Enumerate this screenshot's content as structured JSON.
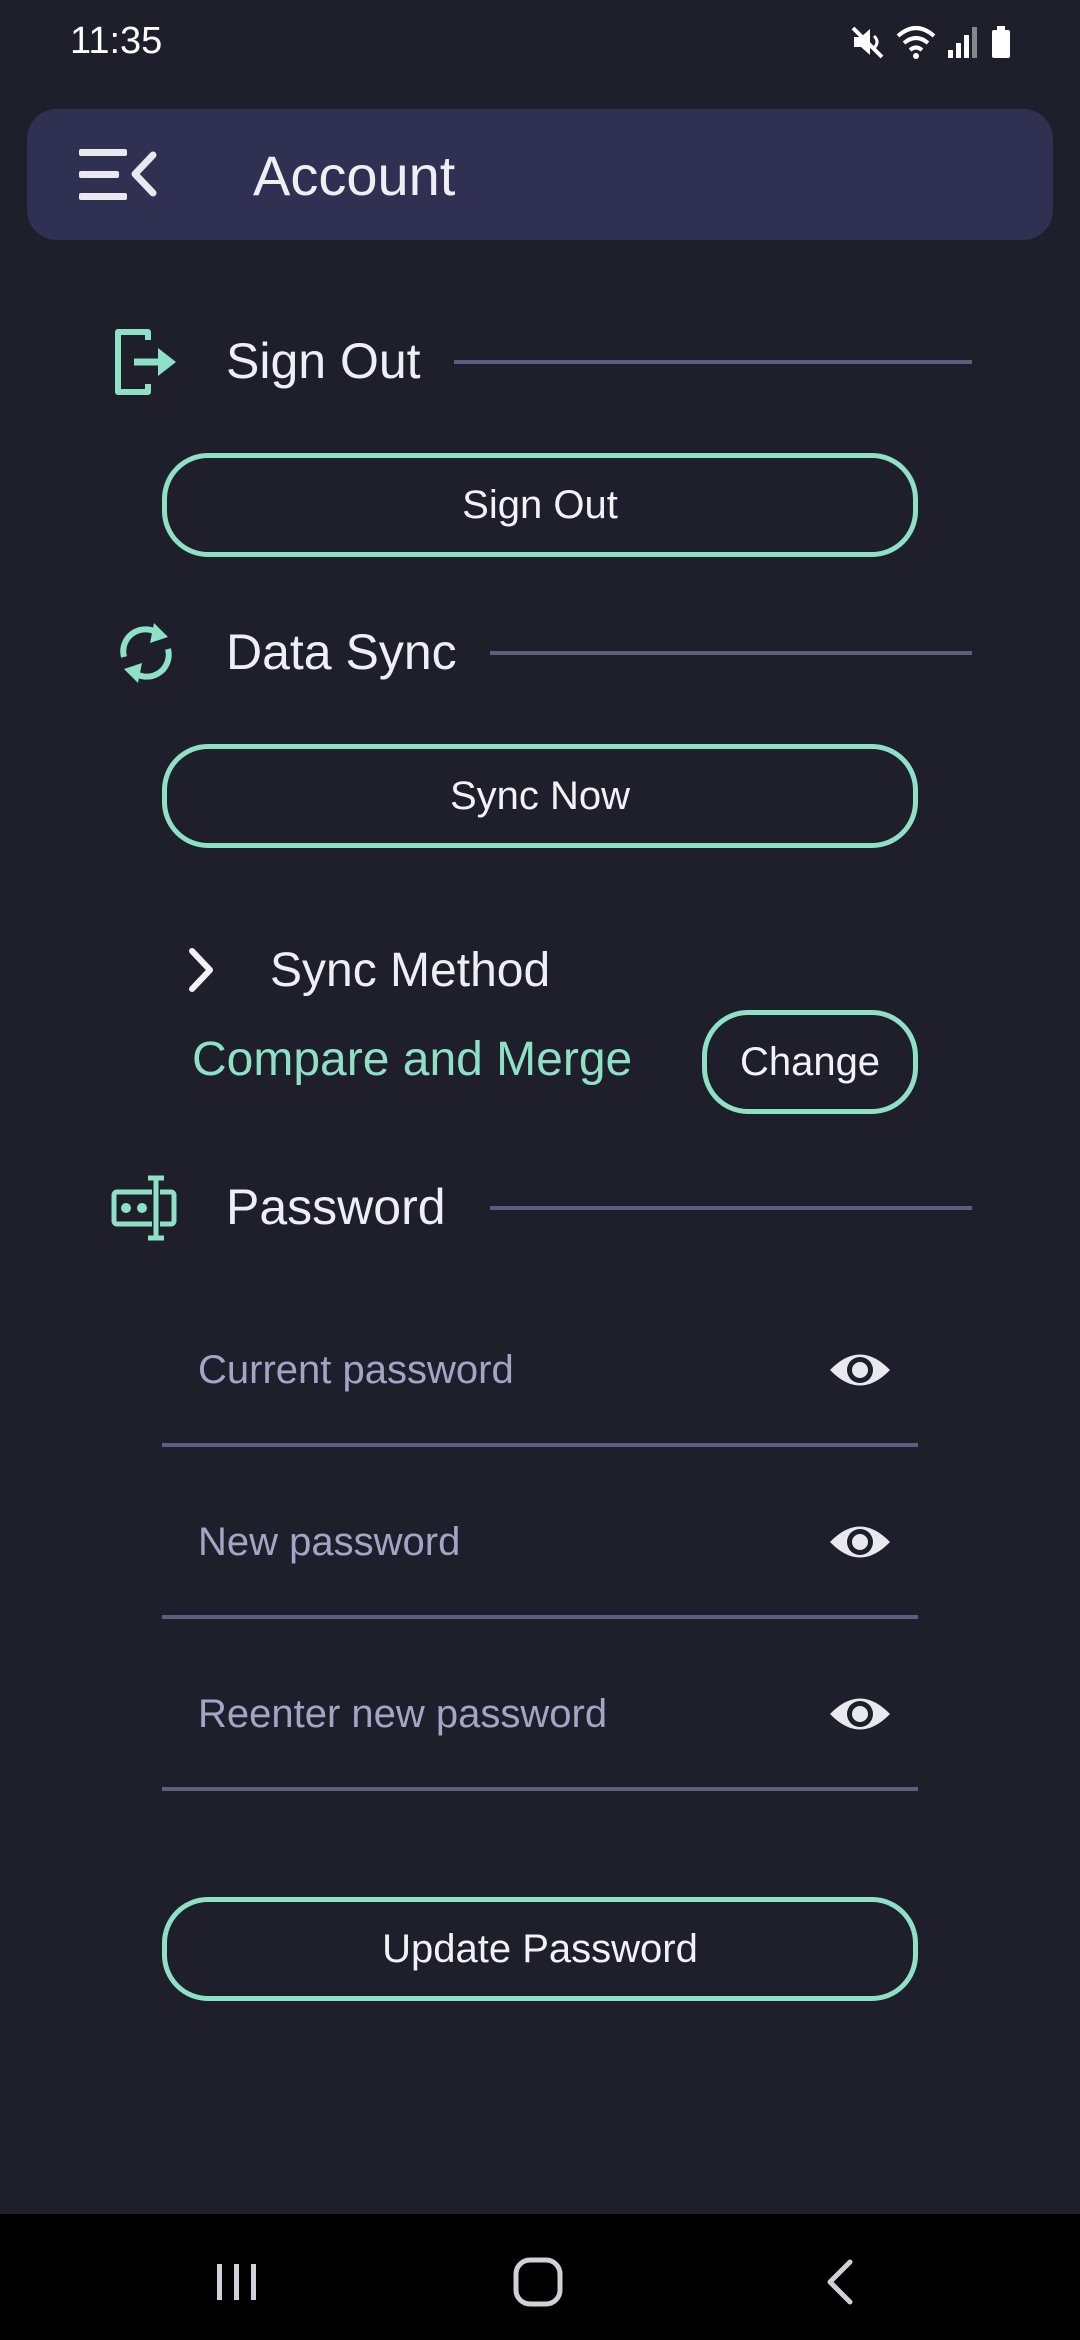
{
  "status_bar": {
    "time": "11:35",
    "icons": [
      "mute-icon",
      "wifi-icon",
      "signal-icon",
      "battery-icon"
    ]
  },
  "app_bar": {
    "title": "Account",
    "menu_icon": "menu-collapse-icon"
  },
  "sections": {
    "sign_out": {
      "title": "Sign Out",
      "icon": "logout-icon",
      "button_label": "Sign Out"
    },
    "data_sync": {
      "title": "Data Sync",
      "icon": "sync-icon",
      "button_label": "Sync Now",
      "sync_method": {
        "title": "Sync Method",
        "value": "Compare and Merge",
        "change_label": "Change"
      }
    },
    "password": {
      "title": "Password",
      "icon": "password-icon",
      "fields": {
        "current": {
          "placeholder": "Current password",
          "value": ""
        },
        "new": {
          "placeholder": "New password",
          "value": ""
        },
        "reenter": {
          "placeholder": "Reenter new password",
          "value": ""
        }
      },
      "update_label": "Update Password"
    }
  },
  "nav_bar": {
    "icons": [
      "recents-icon",
      "home-icon",
      "back-icon"
    ]
  },
  "colors": {
    "background": "#1e1f2b",
    "app_bar": "#2f3052",
    "accent": "#8ee0c6",
    "divider": "#5e5c80",
    "placeholder": "#a6a4c6"
  }
}
